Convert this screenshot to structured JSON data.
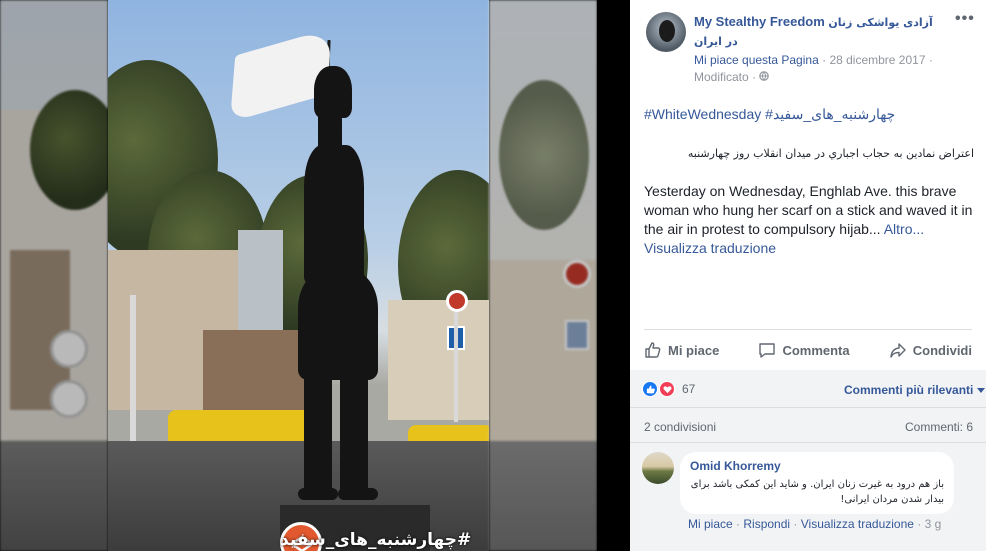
{
  "photo": {
    "overlay_hashtag": "#چهارشنبه_های_سفید"
  },
  "post": {
    "page_name": "My Stealthy Freedom",
    "page_name_fa": "آزادی یواشکی زنان در ایران",
    "like_page": "Mi piace questa Pagina",
    "date": "28 dicembre 2017",
    "edited": "Modificato",
    "more_options": "•••",
    "hashtags": "#WhiteWednesday #چهارشنبه_های_سفید",
    "text_fa": "اعتراض نمادین به حجاب اجباري در میدان انقلاب روز چهارشنبه",
    "text_en": "Yesterday on Wednesday, Enghlab Ave. this brave woman who hung her scarf on a stick and waved it in the air in protest to compulsory hijab... ",
    "see_more": "Altro...",
    "see_translation": "Visualizza traduzione"
  },
  "actions": {
    "like": "Mi piace",
    "comment": "Commenta",
    "share": "Condividi"
  },
  "stats": {
    "reactions_count": "67",
    "sort_label": "Commenti più rilevanti",
    "shares": "2 condivisioni",
    "comments": "Commenti: 6"
  },
  "comment": {
    "author": "Omid Khorremy",
    "text": "باز هم درود به غیرت زنان ایران. و شاید این کمکی باشد برای بیدار شدن مردان ایرانی!",
    "like": "Mi piace",
    "reply": "Rispondi",
    "translate": "Visualizza traduzione",
    "time": "3 g"
  },
  "colors": {
    "link_blue": "#365899",
    "like_blue": "#1877f2",
    "love_red": "#f33e58",
    "grey_text": "#606770",
    "band_bg": "#f2f3f5"
  }
}
